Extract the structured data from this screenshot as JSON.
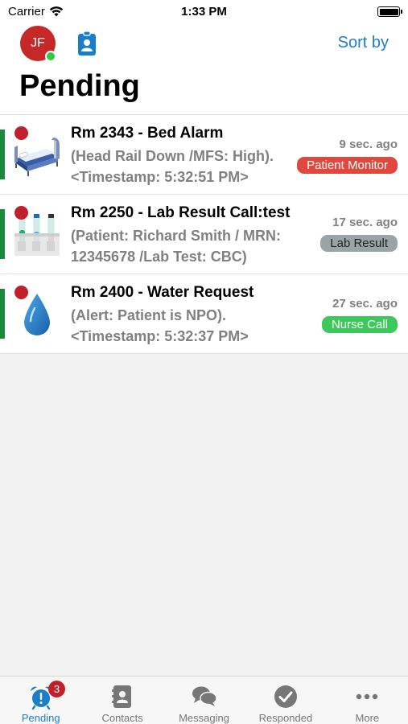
{
  "status_bar": {
    "carrier": "Carrier",
    "time": "1:33 PM"
  },
  "header": {
    "avatar_initials": "JF",
    "sort_label": "Sort by",
    "title": "Pending"
  },
  "alerts": [
    {
      "title": "Rm 2343 - Bed Alarm",
      "detail": "(Head Rail Down /MFS: High). <Timestamp: 5:32:51 PM>",
      "age": "9 sec. ago",
      "tag": "Patient Monitor",
      "tag_color": "#e0483e",
      "icon": "hospital-bed-icon"
    },
    {
      "title": "Rm 2250 - Lab Result Call:test",
      "detail": "(Patient: Richard Smith / MRN: 12345678 /Lab Test: CBC)",
      "age": "17 sec. ago",
      "tag": "Lab Result",
      "tag_color": "#9aa3a6",
      "icon": "test-tubes-icon"
    },
    {
      "title": "Rm 2400 - Water Request",
      "detail": "(Alert: Patient is NPO). <Timestamp: 5:32:37 PM>",
      "age": "27 sec. ago",
      "tag": "Nurse Call",
      "tag_color": "#3cc85a",
      "icon": "water-drop-icon"
    }
  ],
  "tabs": [
    {
      "label": "Pending",
      "icon": "alarm-clock-icon",
      "badge": "3",
      "active": true
    },
    {
      "label": "Contacts",
      "icon": "contacts-book-icon"
    },
    {
      "label": "Messaging",
      "icon": "chat-bubbles-icon"
    },
    {
      "label": "Responded",
      "icon": "checkmark-circle-icon"
    },
    {
      "label": "More",
      "icon": "ellipsis-icon"
    }
  ],
  "colors": {
    "accent": "#1a7fc8",
    "alert_dot": "#c0202b",
    "priority_bar": "#1a8a3c"
  }
}
